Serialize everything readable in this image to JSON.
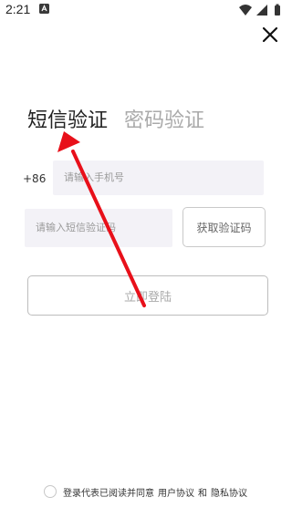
{
  "status_bar": {
    "time": "2:21",
    "icons": [
      "notification-icon",
      "wifi-icon",
      "signal-icon",
      "battery-icon"
    ]
  },
  "tabs": [
    {
      "label": "短信验证",
      "active": true
    },
    {
      "label": "密码验证",
      "active": false
    }
  ],
  "phone": {
    "country_code": "+86",
    "placeholder": "请输入手机号"
  },
  "sms": {
    "placeholder": "请输入短信验证码",
    "get_code_label": "获取验证码"
  },
  "login_label": "立即登陆",
  "agreement": {
    "text": "登录代表已阅读并同意",
    "user_agreement": "用户协议",
    "and": "和",
    "privacy_policy": "隐私协议"
  },
  "colors": {
    "annotation_arrow": "#e8101a",
    "input_bg": "#f3f2f7"
  }
}
